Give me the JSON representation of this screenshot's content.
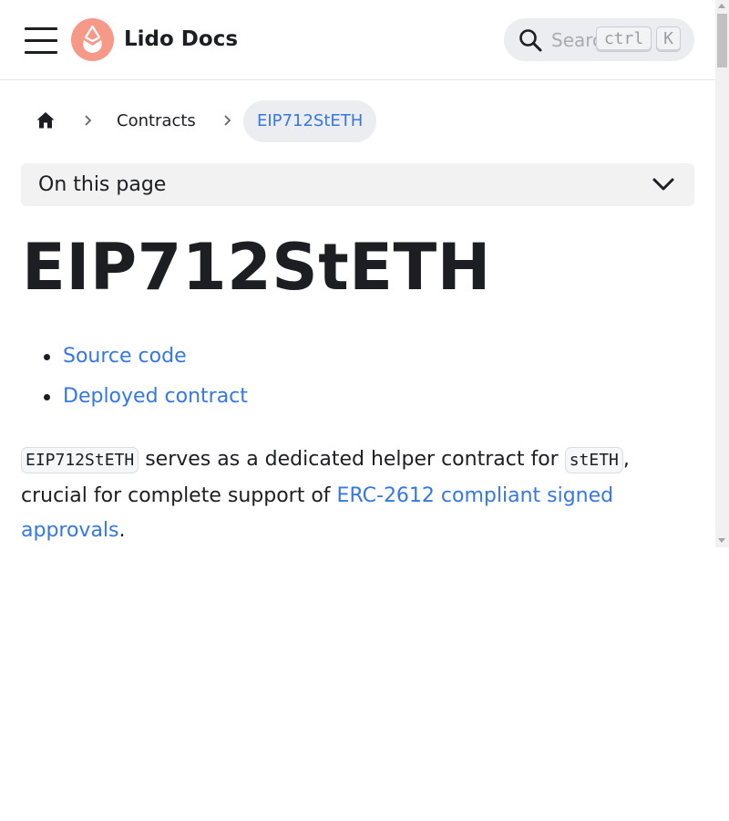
{
  "navbar": {
    "brand_title": "Lido Docs",
    "search_placeholder": "Search",
    "kbd_ctrl": "ctrl",
    "kbd_k": "K"
  },
  "breadcrumb": {
    "items": [
      "Contracts",
      "EIP712StETH"
    ]
  },
  "toc": {
    "label": "On this page"
  },
  "page": {
    "title": "EIP712StETH",
    "links": [
      "Source code",
      "Deployed contract"
    ],
    "paragraph": {
      "code1": "EIP712StETH",
      "text1": " serves as a dedicated helper contract for ",
      "code2": "stETH",
      "text2": ", crucial for complete support of ",
      "link": "ERC-2612 compliant signed approvals",
      "text3": "."
    }
  },
  "colors": {
    "accent": "#3578e5",
    "logo": "#f69988",
    "text": "#1c1e21"
  },
  "icons": [
    "menu-icon",
    "lido-logo-icon",
    "search-icon",
    "home-icon",
    "chevron-right-icon",
    "chevron-down-icon"
  ]
}
